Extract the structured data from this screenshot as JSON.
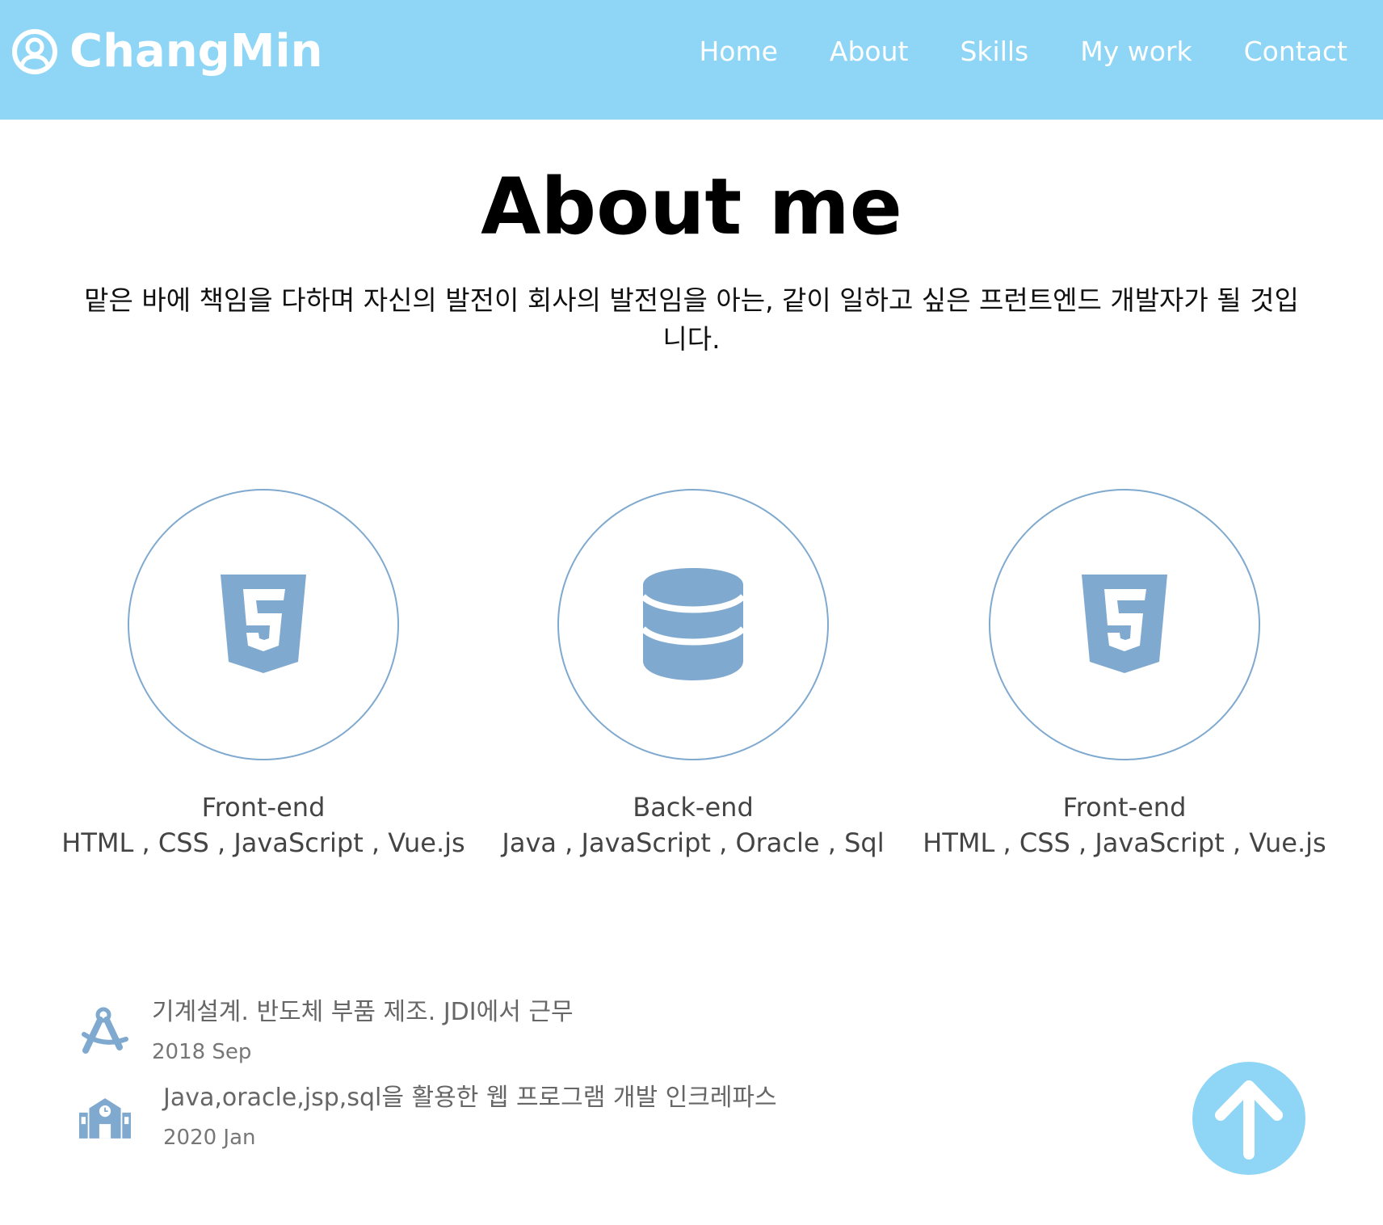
{
  "navbar": {
    "brand_icon": "user-circle-icon",
    "brand_name": "ChangMin",
    "menu": [
      {
        "label": "Home"
      },
      {
        "label": "About"
      },
      {
        "label": "Skills"
      },
      {
        "label": "My work"
      },
      {
        "label": "Contact"
      }
    ],
    "background_color": "#8fd6f6"
  },
  "about": {
    "title": "About me",
    "description": "맡은 바에 책임을 다하며 자신의 발전이 회사의 발전임을 아는, 같이 일하고 싶은 프런트엔드 개발자가 될 것입니다.",
    "majors": [
      {
        "icon": "html5-icon",
        "title": "Front-end",
        "description": "HTML , CSS , JavaScript , Vue.js"
      },
      {
        "icon": "database-icon",
        "title": "Back-end",
        "description": "Java , JavaScript , Oracle , Sql"
      },
      {
        "icon": "html5-icon",
        "title": "Front-end",
        "description": "HTML , CSS , JavaScript , Vue.js"
      }
    ],
    "jobs": [
      {
        "icon": "compass-drafting-icon",
        "name": "기계설계. 반도체 부품 제조. JDI에서 근무",
        "period": "2018 Sep"
      },
      {
        "icon": "school-icon",
        "name": "Java,oracle,jsp,sql을 활용한 웹 프로그램 개발 인크레파스",
        "period": "2020 Jan"
      }
    ],
    "icon_color": "#7fa9cf"
  },
  "scroll_top": {
    "icon": "arrow-up-icon"
  }
}
